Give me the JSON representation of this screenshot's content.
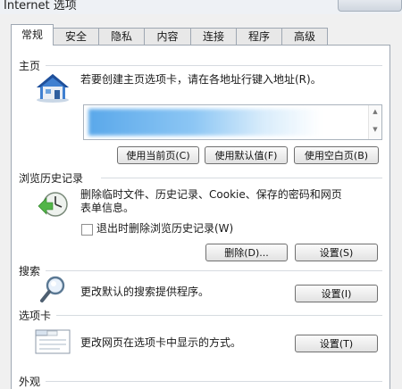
{
  "window": {
    "title": "Internet 选项"
  },
  "tabs": [
    {
      "label": "常规"
    },
    {
      "label": "安全"
    },
    {
      "label": "隐私"
    },
    {
      "label": "内容"
    },
    {
      "label": "连接"
    },
    {
      "label": "程序"
    },
    {
      "label": "高级"
    }
  ],
  "home": {
    "title": "主页",
    "desc": "若要创建主页选项卡，请在各地址行键入地址(R)。",
    "btn_current": "使用当前页(C)",
    "btn_default": "使用默认值(F)",
    "btn_blank": "使用空白页(B)"
  },
  "history": {
    "title": "浏览历史记录",
    "desc_line1": "删除临时文件、历史记录、Cookie、保存的密码和网页",
    "desc_line2": "表单信息。",
    "checkbox_label": "退出时删除浏览历史记录(W)",
    "btn_delete": "删除(D)...",
    "btn_settings": "设置(S)"
  },
  "search": {
    "title": "搜索",
    "desc": "更改默认的搜索提供程序。",
    "btn_settings": "设置(I)"
  },
  "tabs_section": {
    "title": "选项卡",
    "desc": "更改网页在选项卡中显示的方式。",
    "btn_settings": "设置(T)"
  },
  "appearance": {
    "title": "外观"
  }
}
